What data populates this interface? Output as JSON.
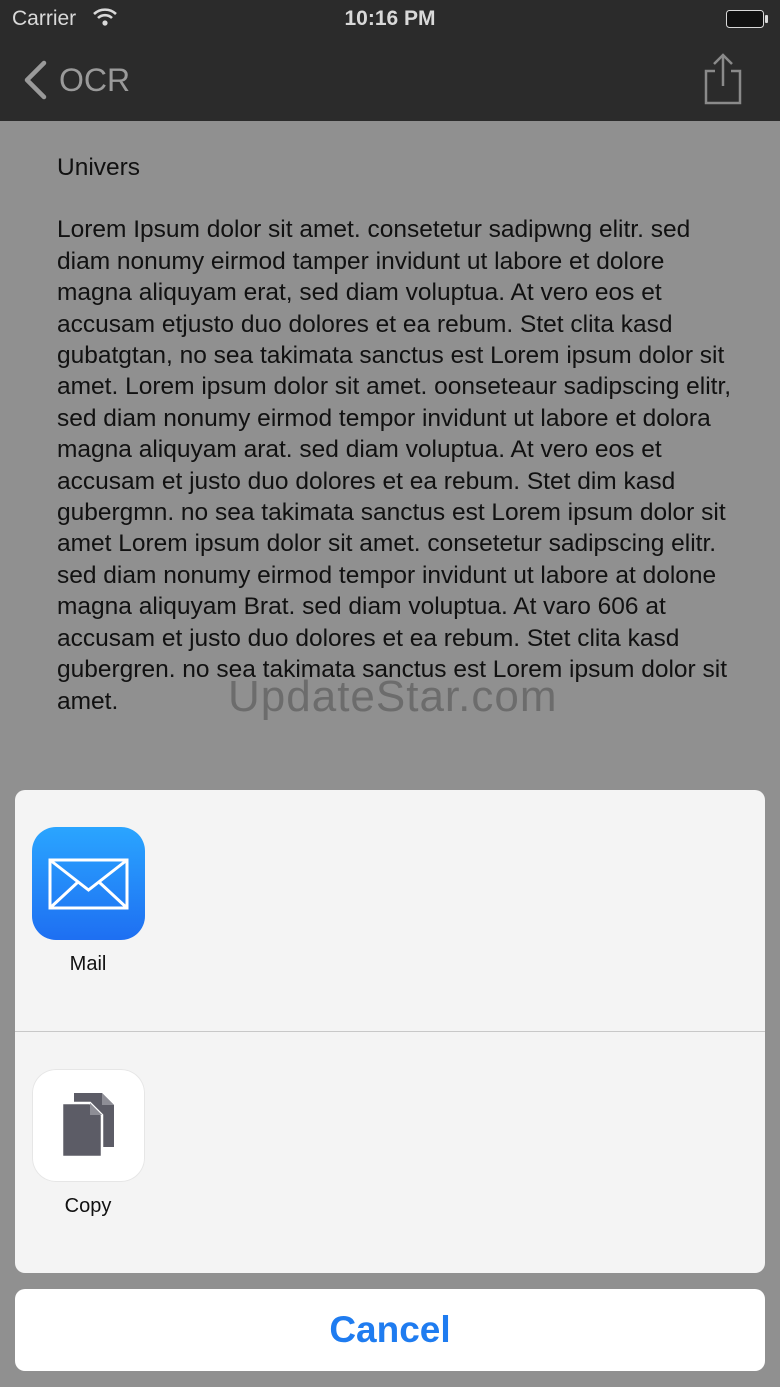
{
  "status_bar": {
    "carrier": "Carrier",
    "time": "10:16 PM",
    "wifi_icon": "wifi-icon",
    "battery_icon": "battery-icon"
  },
  "nav": {
    "back_label": "OCR",
    "back_icon": "chevron-left-icon",
    "share_icon": "share-icon"
  },
  "document": {
    "title": "Univers",
    "body": "Lorem Ipsum dolor sit amet. consetetur sadipwng elitr. sed diam nonumy eirmod tamper invidunt ut labore et dolore magna aliquyam erat, sed diam voluptua. At vero eos et accusam etjusto duo dolores et ea rebum. Stet clita kasd gubatgtan, no sea takimata sanctus est Lorem ipsum dolor sit amet. Lorem ipsum dolor sit amet. oonseteaur sadipscing elitr, sed diam nonumy eirmod tempor invidunt ut labore et dolora magna aliquyam arat. sed diam voluptua. At vero eos et accusam et justo duo dolores et ea rebum. Stet dim kasd gubergmn. no sea takimata sanctus est Lorem ipsum dolor sit amet Lorem ipsum dolor sit amet. consetetur sadipscing elitr. sed diam nonumy eirmod tempor invidunt ut labore at dolone magna aliquyam Brat. sed diam voluptua. At varo 606 at accusam et justo duo dolores et ea rebum. Stet clita kasd gubergren. no sea takimata sanctus est Lorem ipsum dolor sit amet."
  },
  "watermark": "UpdateStar.com",
  "share_sheet": {
    "actions": [
      {
        "label": "Mail",
        "icon": "mail-icon"
      },
      {
        "label": "Copy",
        "icon": "copy-icon"
      }
    ],
    "cancel_label": "Cancel"
  },
  "colors": {
    "bar_background": "#2b2b2b",
    "dimmed_background": "#909090",
    "accent": "#1f7cf0"
  }
}
